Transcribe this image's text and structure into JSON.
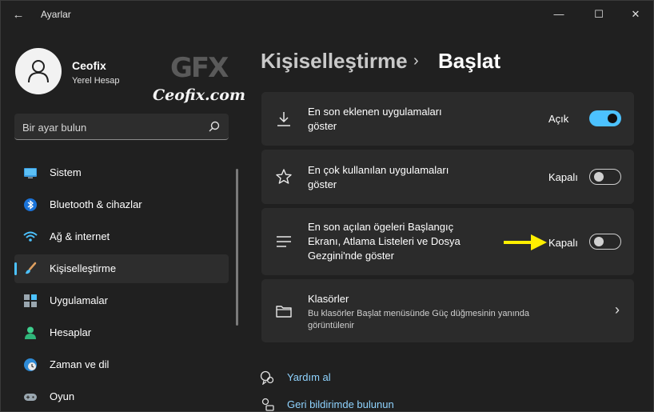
{
  "window": {
    "title": "Ayarlar",
    "back": "←",
    "minimize": "—",
    "maximize": "☐",
    "close": "✕"
  },
  "profile": {
    "name": "Ceofix",
    "account_type": "Yerel Hesap"
  },
  "watermark": {
    "logo": "GFX",
    "site": "Ceofix.com"
  },
  "search": {
    "placeholder": "Bir ayar bulun"
  },
  "sidebar": {
    "items": [
      {
        "label": "Sistem",
        "icon": "monitor-icon"
      },
      {
        "label": "Bluetooth & cihazlar",
        "icon": "bluetooth-icon"
      },
      {
        "label": "Ağ & internet",
        "icon": "wifi-icon"
      },
      {
        "label": "Kişiselleştirme",
        "icon": "paintbrush-icon",
        "active": true
      },
      {
        "label": "Uygulamalar",
        "icon": "apps-icon"
      },
      {
        "label": "Hesaplar",
        "icon": "person-icon"
      },
      {
        "label": "Zaman ve dil",
        "icon": "globe-clock-icon"
      },
      {
        "label": "Oyun",
        "icon": "gamepad-icon"
      }
    ]
  },
  "header": {
    "parent": "Kişiselleştirme",
    "separator": "›",
    "current": "Başlat"
  },
  "settings": [
    {
      "label_line1": "En son eklenen uygulamaları",
      "label_line2": "göster",
      "state_label": "Açık",
      "on": true,
      "icon": "download-icon"
    },
    {
      "label_line1": "En çok kullanılan uygulamaları",
      "label_line2": "göster",
      "state_label": "Kapalı",
      "on": false,
      "icon": "star-icon"
    },
    {
      "label_line1": "En son açılan ögeleri Başlangıç",
      "label_line2": "Ekranı, Atlama Listeleri ve Dosya",
      "label_line3": "Gezgini'nde göster",
      "state_label": "Kapalı",
      "on": false,
      "icon": "list-icon"
    }
  ],
  "folders": {
    "title": "Klasörler",
    "description_line1": "Bu klasörler Başlat menüsünde Güç düğmesinin yanında",
    "description_line2": "görüntülenir",
    "icon": "folder-icon",
    "chevron": "›"
  },
  "links": {
    "help": "Yardım al",
    "feedback": "Geri bildirimde bulunun"
  },
  "colors": {
    "accent": "#4cc2ff",
    "annotation_arrow": "#ffef00",
    "background": "#202020",
    "card": "#2b2b2b"
  }
}
